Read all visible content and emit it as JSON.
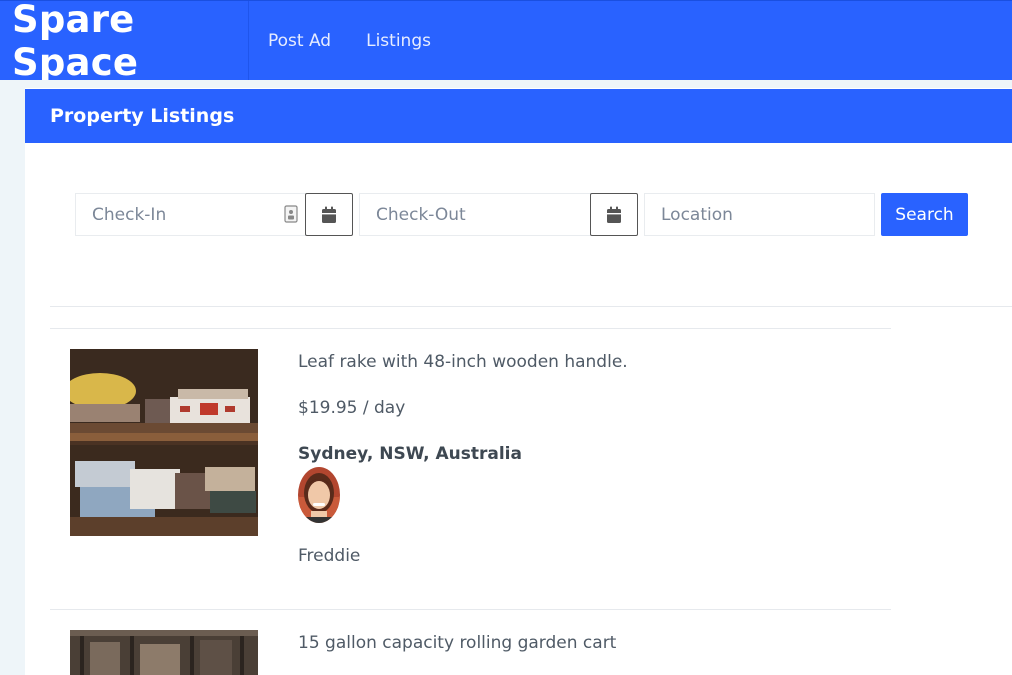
{
  "header": {
    "brand": "Spare Space",
    "nav": [
      {
        "label": "Post Ad"
      },
      {
        "label": "Listings"
      }
    ]
  },
  "card": {
    "title": "Property Listings"
  },
  "search": {
    "checkin_placeholder": "Check-In",
    "checkout_placeholder": "Check-Out",
    "location_placeholder": "Location",
    "button_label": "Search"
  },
  "listings": [
    {
      "description": "Leaf rake with 48-inch wooden handle.",
      "price": "$19.95 / day",
      "location": "Sydney, NSW, Australia",
      "owner": "Freddie"
    },
    {
      "description": "15 gallon capacity rolling garden cart"
    }
  ],
  "colors": {
    "primary": "#2962ff",
    "gutter": "#eef5f9"
  }
}
